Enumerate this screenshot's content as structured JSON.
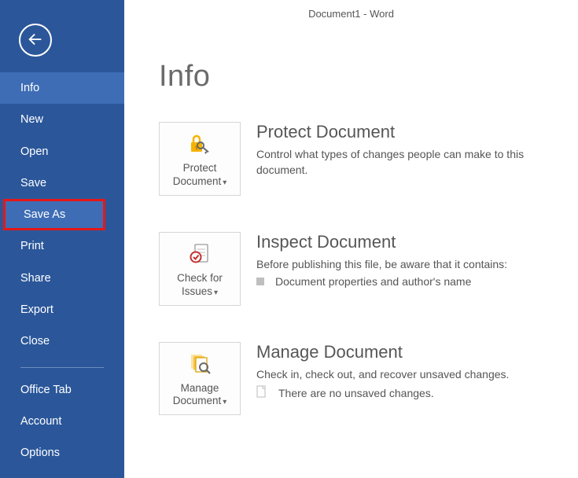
{
  "titlebar": "Document1 - Word",
  "page_title": "Info",
  "sidebar": {
    "items": [
      {
        "label": "Info",
        "active": true
      },
      {
        "label": "New"
      },
      {
        "label": "Open"
      },
      {
        "label": "Save"
      },
      {
        "label": "Save As",
        "highlight": true
      },
      {
        "label": "Print"
      },
      {
        "label": "Share"
      },
      {
        "label": "Export"
      },
      {
        "label": "Close"
      }
    ],
    "lower_items": [
      {
        "label": "Office Tab"
      },
      {
        "label": "Account"
      },
      {
        "label": "Options"
      }
    ]
  },
  "sections": {
    "protect": {
      "tile_line1": "Protect",
      "tile_line2": "Document",
      "heading": "Protect Document",
      "desc": "Control what types of changes people can make to this document."
    },
    "inspect": {
      "tile_line1": "Check for",
      "tile_line2": "Issues",
      "heading": "Inspect Document",
      "desc": "Before publishing this file, be aware that it contains:",
      "bullet": "Document properties and author's name"
    },
    "manage": {
      "tile_line1": "Manage",
      "tile_line2": "Document",
      "heading": "Manage Document",
      "desc": "Check in, check out, and recover unsaved changes.",
      "bullet": "There are no unsaved changes."
    }
  }
}
